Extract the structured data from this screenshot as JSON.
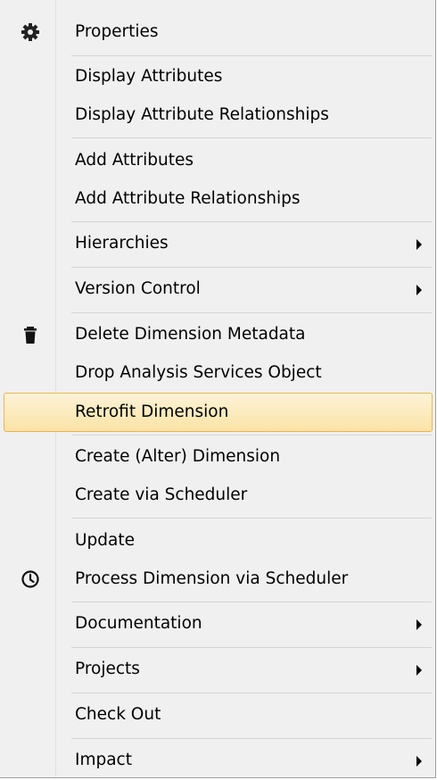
{
  "menu": {
    "items": [
      {
        "label": "Properties",
        "icon": "gear-icon",
        "submenu": false
      },
      {
        "label": "Display Attributes",
        "submenu": false
      },
      {
        "label": "Display Attribute Relationships",
        "submenu": false
      },
      {
        "label": "Add Attributes",
        "submenu": false
      },
      {
        "label": "Add Attribute Relationships",
        "submenu": false
      },
      {
        "label": "Hierarchies",
        "submenu": true
      },
      {
        "label": "Version Control",
        "submenu": true
      },
      {
        "label": "Delete Dimension Metadata",
        "icon": "trash-icon",
        "submenu": false
      },
      {
        "label": "Drop Analysis Services Object",
        "submenu": false
      },
      {
        "label": "Retrofit Dimension",
        "submenu": false,
        "highlighted": true
      },
      {
        "label": "Create  (Alter) Dimension",
        "submenu": false
      },
      {
        "label": "Create via Scheduler",
        "submenu": false
      },
      {
        "label": "Update",
        "submenu": false
      },
      {
        "label": "Process Dimension via Scheduler",
        "icon": "clock-icon",
        "submenu": false
      },
      {
        "label": "Documentation",
        "submenu": true
      },
      {
        "label": "Projects",
        "submenu": true
      },
      {
        "label": "Check Out",
        "submenu": false
      },
      {
        "label": "Impact",
        "submenu": true
      }
    ]
  },
  "colors": {
    "menu_bg": "#f0f0f0",
    "highlight_bg": "#fbe3a6",
    "highlight_border": "#e6b855",
    "separator": "#d4d4d4"
  }
}
